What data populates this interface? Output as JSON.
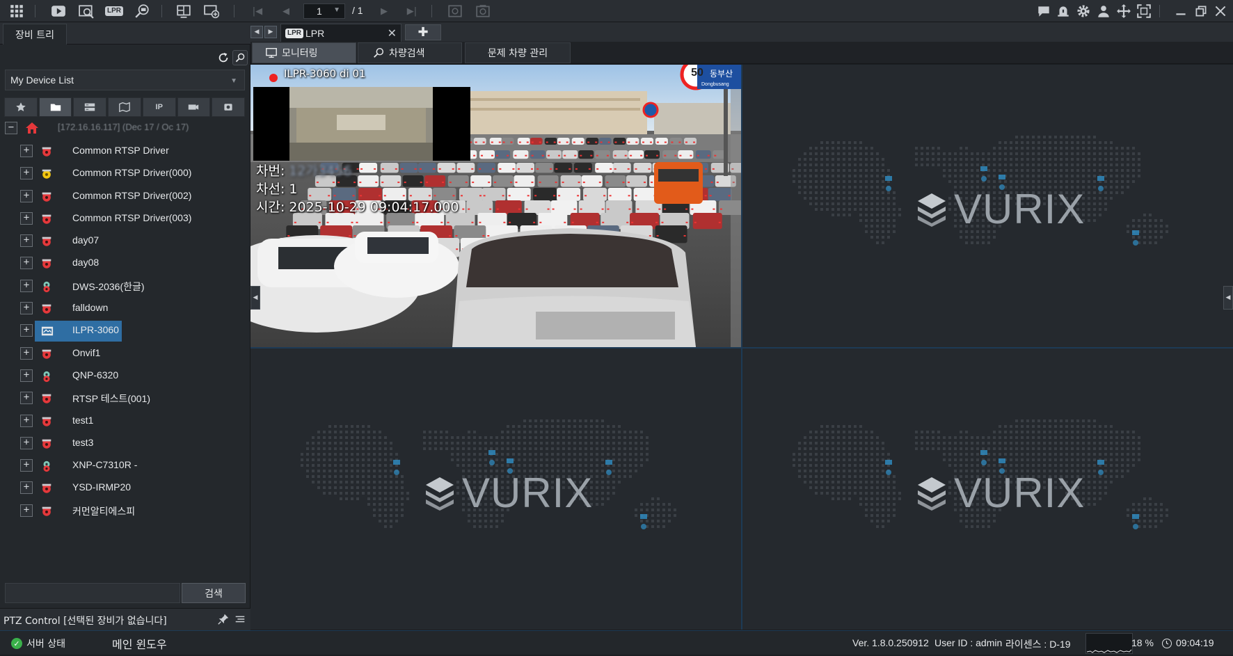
{
  "toolbar": {
    "page_current": "1",
    "page_total": "/ 1",
    "lpr_button": "LPR"
  },
  "left_panel": {
    "tab_label": "장비 트리",
    "device_list_select": "My Device List",
    "filter_ip_label": "IP",
    "root_node": "[172.16.16.117] (Dec 17 / Oc 17)",
    "devices": [
      {
        "label": "Common RTSP Driver",
        "icon": "camera-red-icon"
      },
      {
        "label": "Common RTSP Driver(000)",
        "icon": "camera-yellow-icon"
      },
      {
        "label": "Common RTSP Driver(002)",
        "icon": "camera-red-icon"
      },
      {
        "label": "Common RTSP Driver(003)",
        "icon": "camera-red-icon"
      },
      {
        "label": "day07",
        "icon": "camera-red-icon"
      },
      {
        "label": "day08",
        "icon": "camera-red-icon"
      },
      {
        "label": "DWS-2036(한글)",
        "icon": "camera-multi-icon"
      },
      {
        "label": "falldown",
        "icon": "camera-red-icon"
      },
      {
        "label": "ILPR-3060",
        "icon": "lpr-device-icon"
      },
      {
        "label": "Onvif1",
        "icon": "camera-red-icon"
      },
      {
        "label": "QNP-6320",
        "icon": "camera-multi-icon"
      },
      {
        "label": "RTSP 테스트(001)",
        "icon": "camera-red-icon"
      },
      {
        "label": "test1",
        "icon": "camera-red-icon"
      },
      {
        "label": "test3",
        "icon": "camera-red-icon"
      },
      {
        "label": "XNP-C7310R -",
        "icon": "camera-multi-icon"
      },
      {
        "label": "YSD-IRMP20",
        "icon": "camera-red-icon"
      },
      {
        "label": "커먼알티에스피",
        "icon": "camera-red-icon"
      }
    ],
    "selected_device": "ILPR-3060",
    "search_button": "검색",
    "ptz_label": "PTZ Control [선택된 장비가 없습니다]"
  },
  "main": {
    "tab_label": "LPR",
    "tab_badge": "LPR",
    "subtabs": [
      "모니터링",
      "차량검색",
      "문제 차량 관리"
    ],
    "active_subtab": "모니터링",
    "camera": {
      "title": "ILPR-3060 di 01",
      "plate_label": "차번: ",
      "plate_value": "12가3456",
      "lane": "차선: 1",
      "time": "시간: 2025-10-29 09:04:17.000",
      "speed_sign": "50",
      "road_sign": "동부산",
      "road_sign_en": "Dongbusang"
    },
    "empty_logo_text": "VURIX"
  },
  "statusbar": {
    "server_status": "서버 상태",
    "main_window": "메인 윈도우",
    "version": "Ver. 1.8.0.250912",
    "user_id": "User ID : admin",
    "license": "라이센스 : D-19",
    "cpu": "18 %",
    "clock": "09:04:19"
  },
  "colors": {
    "selected_row": "#2f6ea3",
    "grid_line": "#1d3a55",
    "recording": "#ee2222",
    "status_ok": "#3ab04a"
  }
}
